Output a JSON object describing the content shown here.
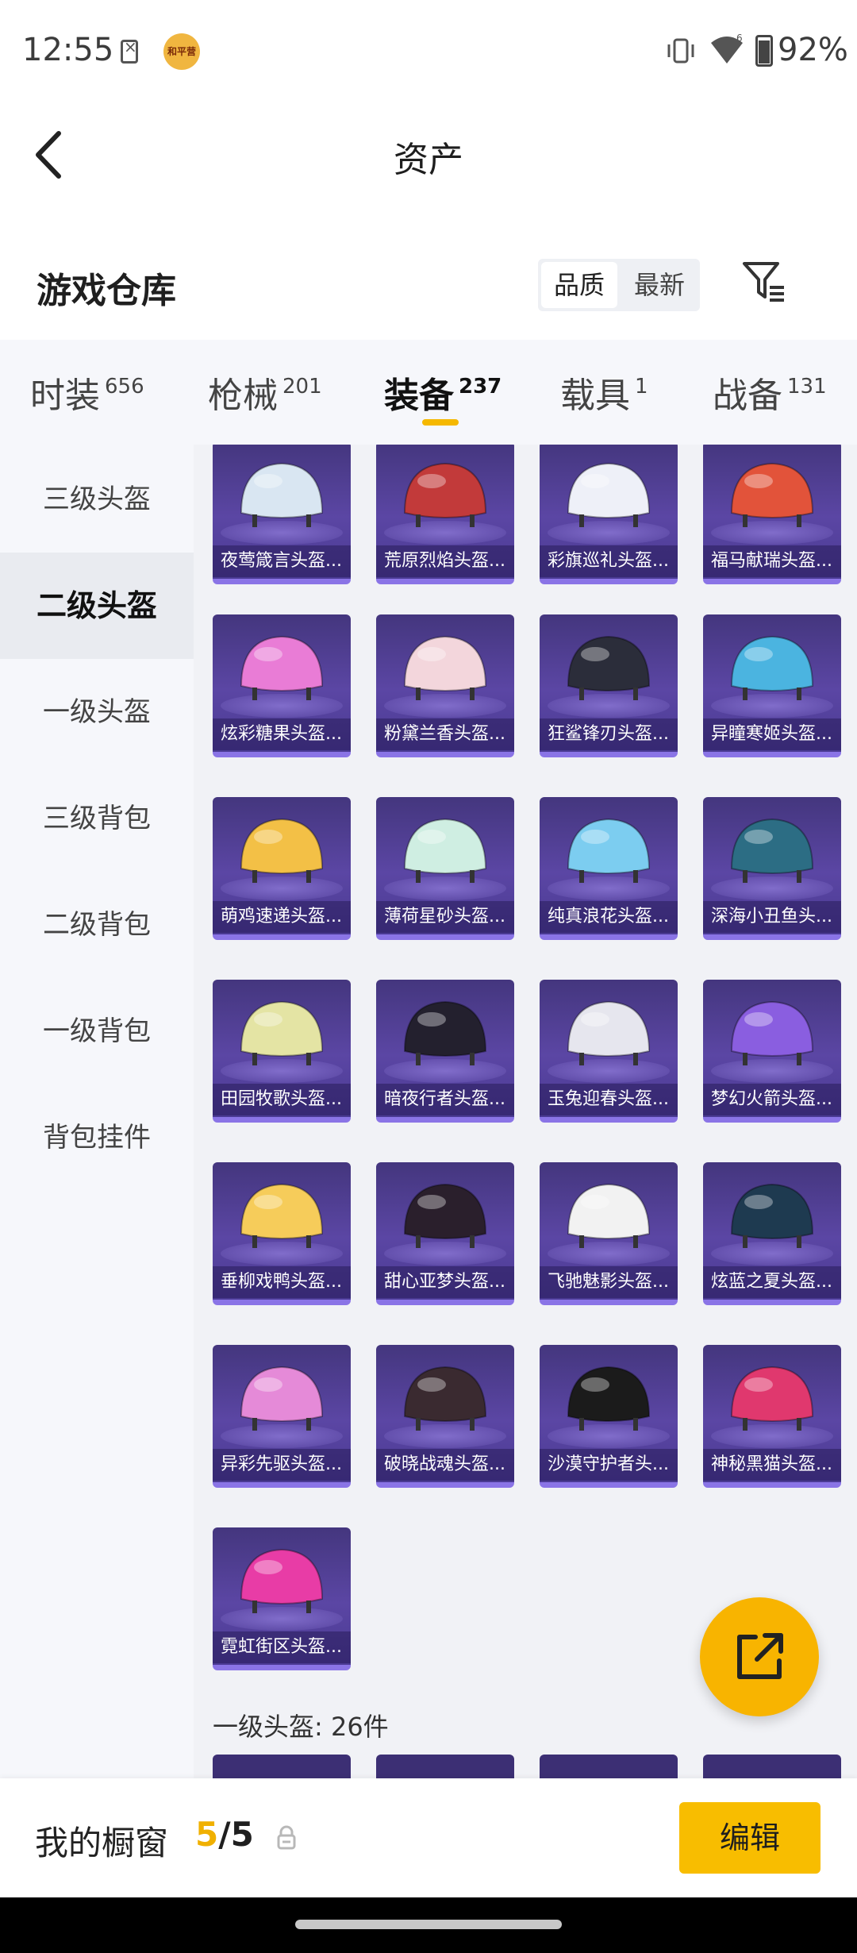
{
  "status_bar": {
    "time": "12:55",
    "app_badge": "和平营地",
    "battery": "92%"
  },
  "header": {
    "title": "资产"
  },
  "warehouse": {
    "title": "游戏仓库",
    "sort": {
      "quality": "品质",
      "newest": "最新"
    }
  },
  "tabs": [
    {
      "label": "时装",
      "count": "656"
    },
    {
      "label": "枪械",
      "count": "201"
    },
    {
      "label": "装备",
      "count": "237"
    },
    {
      "label": "载具",
      "count": "1"
    },
    {
      "label": "战备",
      "count": "131"
    }
  ],
  "sidebar": {
    "items": [
      {
        "label": "三级头盔"
      },
      {
        "label": "二级头盔"
      },
      {
        "label": "一级头盔"
      },
      {
        "label": "三级背包"
      },
      {
        "label": "二级背包"
      },
      {
        "label": "一级背包"
      },
      {
        "label": "背包挂件"
      }
    ]
  },
  "items": [
    {
      "name": "夜莺箴言头盔...",
      "color": "#d9e6f2"
    },
    {
      "name": "荒原烈焰头盔...",
      "color": "#c23a3a"
    },
    {
      "name": "彩旗巡礼头盔...",
      "color": "#eef0f8"
    },
    {
      "name": "福马献瑞头盔...",
      "color": "#e2533a"
    },
    {
      "name": "炫彩糖果头盔...",
      "color": "#e97cd6"
    },
    {
      "name": "粉黛兰香头盔...",
      "color": "#f3d6dc"
    },
    {
      "name": "狂鲨锋刃头盔...",
      "color": "#2b2d3a"
    },
    {
      "name": "异瞳寒姬头盔...",
      "color": "#4bb4e0"
    },
    {
      "name": "萌鸡速递头盔...",
      "color": "#f3c046"
    },
    {
      "name": "薄荷星砂头盔...",
      "color": "#cfeee2"
    },
    {
      "name": "纯真浪花头盔...",
      "color": "#7ccdf0"
    },
    {
      "name": "深海小丑鱼头...",
      "color": "#2c6d84"
    },
    {
      "name": "田园牧歌头盔...",
      "color": "#e4e4a4"
    },
    {
      "name": "暗夜行者头盔...",
      "color": "#23202e"
    },
    {
      "name": "玉兔迎春头盔...",
      "color": "#e6e6ee"
    },
    {
      "name": "梦幻火箭头盔...",
      "color": "#8a5ee0"
    },
    {
      "name": "垂柳戏鸭头盔...",
      "color": "#f6cc5a"
    },
    {
      "name": "甜心亚梦头盔...",
      "color": "#2a1f2c"
    },
    {
      "name": "飞驰魅影头盔...",
      "color": "#f2f2f2"
    },
    {
      "name": "炫蓝之夏头盔...",
      "color": "#1e3a50"
    },
    {
      "name": "异彩先驱头盔...",
      "color": "#e58ad8"
    },
    {
      "name": "破晓战魂头盔...",
      "color": "#3a2a30"
    },
    {
      "name": "沙漠守护者头...",
      "color": "#1b1b1b"
    },
    {
      "name": "神秘黑猫头盔...",
      "color": "#e0386e"
    },
    {
      "name": "霓虹街区头盔...",
      "color": "#e83ca6"
    }
  ],
  "section_label": "一级头盔: 26件",
  "bottom_bar": {
    "label": "我的橱窗",
    "count_current": "5",
    "count_separator": "/",
    "count_total": "5",
    "edit_label": "编辑"
  }
}
